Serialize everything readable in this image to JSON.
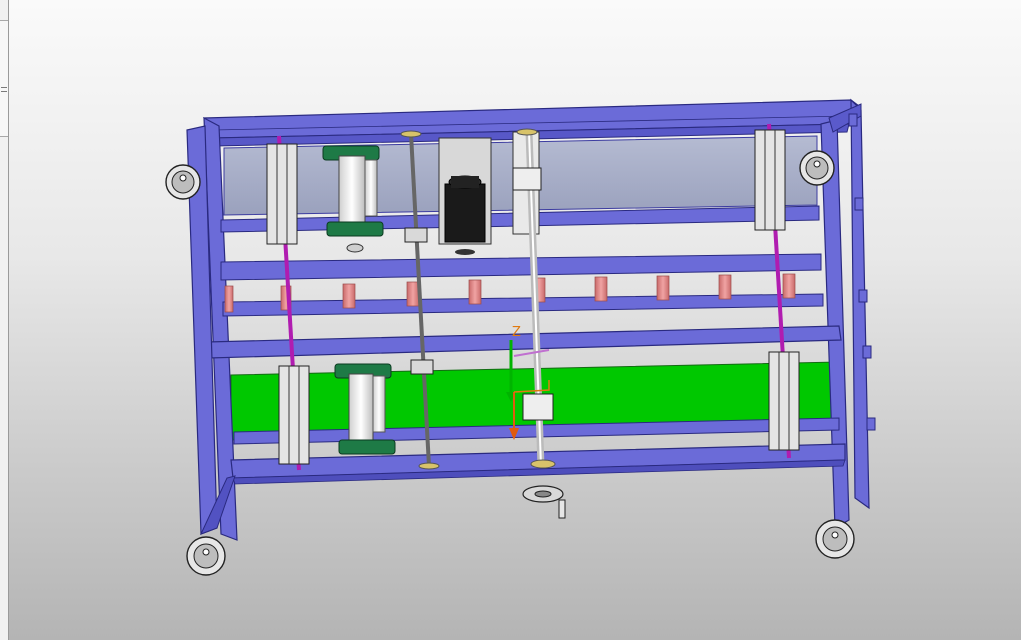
{
  "left_panel": {
    "resize_handle": "panel-resize-grip"
  },
  "viewport": {
    "model": "frame-assembly",
    "colors": {
      "frame": "#6b6bd8",
      "frame_dark": "#3c3ca0",
      "panel_top": "#a8aec8",
      "panel_bottom": "#00c800",
      "rod_magenta": "#b01cb0",
      "roller": "#e58d8d",
      "bearing_green": "#1e7a46",
      "motor": "#1a1a1a"
    },
    "axis_triad": {
      "z_label": "Z"
    }
  }
}
